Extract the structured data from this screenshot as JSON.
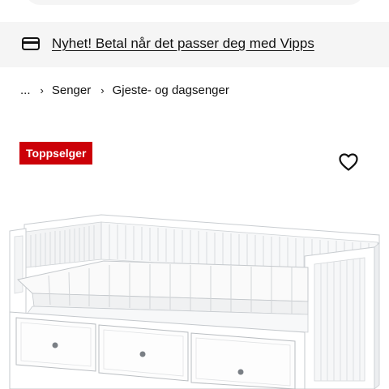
{
  "promo": {
    "text": "Nyhet! Betal når det passer deg med Vipps",
    "icon": "credit-card-icon"
  },
  "breadcrumb": {
    "ellipsis": "...",
    "items": [
      "Senger",
      "Gjeste- og dagsenger"
    ]
  },
  "badge": {
    "label": "Toppselger",
    "color": "#cc0008"
  },
  "favourite": {
    "icon": "heart-outline-icon"
  },
  "product_image": {
    "subject": "white daybed with three drawers and mattress"
  }
}
